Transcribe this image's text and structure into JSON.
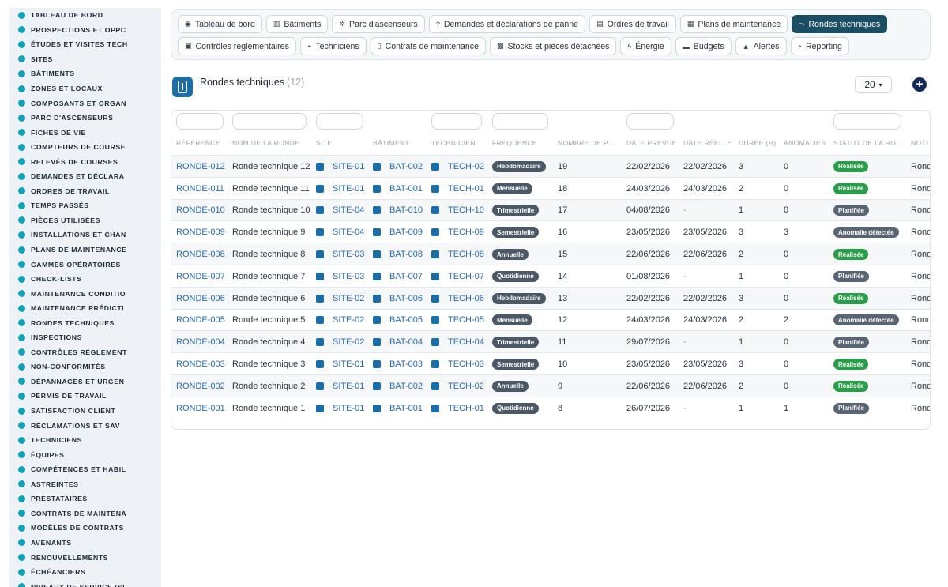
{
  "sidebar": {
    "items": [
      {
        "label": "TABLEAU DE BORD",
        "icon": "dashboard-icon"
      },
      {
        "label": "PROSPECTIONS ET OPPC",
        "icon": "target-icon"
      },
      {
        "label": "ÉTUDES ET VISITES TECH",
        "icon": "document-icon"
      },
      {
        "label": "SITES",
        "icon": "map-pin-icon"
      },
      {
        "label": "BÂTIMENTS",
        "icon": "building-icon"
      },
      {
        "label": "ZONES ET LOCAUX",
        "icon": "door-icon"
      },
      {
        "label": "COMPOSANTS ET ORGAN",
        "icon": "sitemap-icon"
      },
      {
        "label": "PARC D'ASCENSEURS",
        "icon": "gears-icon"
      },
      {
        "label": "FICHES DE VIE",
        "icon": "history-icon"
      },
      {
        "label": "COMPTEURS DE COURSE",
        "icon": "gauge-icon"
      },
      {
        "label": "RELEVÉS DE COURSES",
        "icon": "clipboard-icon"
      },
      {
        "label": "DEMANDES ET DÉCLARA",
        "icon": "question-icon"
      },
      {
        "label": "ORDRES DE TRAVAIL",
        "icon": "clipboard-list-icon"
      },
      {
        "label": "TEMPS PASSÉS",
        "icon": "clock-icon"
      },
      {
        "label": "PIÈCES UTILISÉES",
        "icon": "box-icon"
      },
      {
        "label": "INSTALLATIONS ET CHAN",
        "icon": "hammer-icon"
      },
      {
        "label": "PLANS DE MAINTENANCE",
        "icon": "calendar-icon"
      },
      {
        "label": "GAMMES OPÉRATOIRES",
        "icon": "list-icon"
      },
      {
        "label": "CHECK-LISTS",
        "icon": "checklist-icon"
      },
      {
        "label": "MAINTENANCE CONDITIO",
        "icon": "thermometer-icon"
      },
      {
        "label": "MAINTENANCE PRÉDICTI",
        "icon": "chart-icon"
      },
      {
        "label": "RONDES TECHNIQUES",
        "icon": "route-icon"
      },
      {
        "label": "INSPECTIONS",
        "icon": "search-icon"
      },
      {
        "label": "CONTRÔLES RÉGLEMENT",
        "icon": "check-document-icon"
      },
      {
        "label": "NON-CONFORMITÉS",
        "icon": "alert-circle-icon"
      },
      {
        "label": "DÉPANNAGES ET URGEN",
        "icon": "warning-icon"
      },
      {
        "label": "PERMIS DE TRAVAIL",
        "icon": "id-card-icon"
      },
      {
        "label": "SATISFACTION CLIENT",
        "icon": "smile-icon"
      },
      {
        "label": "RÉCLAMATIONS ET SAV",
        "icon": "comment-icon"
      },
      {
        "label": "TECHNICIENS",
        "icon": "helmet-icon"
      },
      {
        "label": "ÉQUIPES",
        "icon": "users-icon"
      },
      {
        "label": "COMPÉTENCES ET HABIL",
        "icon": "certificate-icon"
      },
      {
        "label": "ASTREINTES",
        "icon": "phone-icon"
      },
      {
        "label": "PRESTATAIRES",
        "icon": "briefcase-icon"
      },
      {
        "label": "CONTRATS DE MAINTENA",
        "icon": "file-contract-icon"
      },
      {
        "label": "MODÈLES DE CONTRATS",
        "icon": "file-icon"
      },
      {
        "label": "AVENANTS",
        "icon": "file-edit-icon"
      },
      {
        "label": "RENOUVELLEMENTS",
        "icon": "refresh-icon"
      },
      {
        "label": "ÉCHÉANCIERS",
        "icon": "file-calendar-icon"
      },
      {
        "label": "NIVEAUX DE SERVICE (SL",
        "icon": "layers-icon"
      }
    ]
  },
  "nav": {
    "row1": [
      {
        "label": "Tableau de bord",
        "icon": "gauge-icon",
        "glyph": "◉",
        "active": false
      },
      {
        "label": "Bâtiments",
        "icon": "building-icon",
        "glyph": "▥",
        "active": false
      },
      {
        "label": "Parc d'ascenseurs",
        "icon": "gears-icon",
        "glyph": "✲",
        "active": false
      },
      {
        "label": "Demandes et déclarations de panne",
        "icon": "question-icon",
        "glyph": "?",
        "active": false
      },
      {
        "label": "Ordres de travail",
        "icon": "clipboard-icon",
        "glyph": "▤",
        "active": false
      },
      {
        "label": "Plans de maintenance",
        "icon": "calendar-icon",
        "glyph": "▦",
        "active": false
      },
      {
        "label": "Rondes techniques",
        "icon": "route-icon",
        "glyph": "⤳",
        "active": true
      }
    ],
    "row2": [
      {
        "label": "Contrôles réglementaires",
        "icon": "check-document-icon",
        "glyph": "▣",
        "active": false
      },
      {
        "label": "Techniciens",
        "icon": "helmet-icon",
        "glyph": "◓",
        "active": false
      },
      {
        "label": "Contrats de maintenance",
        "icon": "file-contract-icon",
        "glyph": "▯",
        "active": false
      },
      {
        "label": "Stocks et pièces détachées",
        "icon": "boxes-icon",
        "glyph": "▩",
        "active": false
      },
      {
        "label": "Énergie",
        "icon": "bolt-icon",
        "glyph": "ϟ",
        "active": false
      },
      {
        "label": "Budgets",
        "icon": "money-icon",
        "glyph": "▬",
        "active": false
      },
      {
        "label": "Alertes",
        "icon": "bell-icon",
        "glyph": "▲",
        "active": false
      },
      {
        "label": "Reporting",
        "icon": "pie-chart-icon",
        "glyph": "◔",
        "active": false
      }
    ]
  },
  "header": {
    "title": "Rondes techniques",
    "count": "(12)",
    "per_page": "20",
    "add_label": "+"
  },
  "table": {
    "columns": [
      "RÉFÉRENCE",
      "NOM DE LA RONDE",
      "SITE",
      "BÂTIMENT",
      "TECHNICIEN",
      "FRÉQUENCE",
      "NOMBRE DE P…",
      "DATE PRÉVUE",
      "DATE RÉELLE",
      "DURÉE (H)",
      "ANOMALIES",
      "STATUT DE LA RO…",
      "NOTE"
    ],
    "status_colors": {
      "Réalisée": "#2a9d4a",
      "Planifiée": "#5a6573",
      "Anomalie détectée": "#5a6573"
    },
    "rows": [
      {
        "ref": "RONDE-012",
        "name": "Ronde technique 12",
        "site": "SITE-01",
        "batiment": "BAT-002",
        "tech": "TECH-02",
        "freq": "Hebdomadaire",
        "points": "19",
        "prevue": "22/02/2026",
        "reelle": "22/02/2026",
        "duree": "3",
        "anomalies": "0",
        "statut": "Réalisée",
        "note": "Ronde"
      },
      {
        "ref": "RONDE-011",
        "name": "Ronde technique 11",
        "site": "SITE-01",
        "batiment": "BAT-001",
        "tech": "TECH-01",
        "freq": "Mensuelle",
        "points": "18",
        "prevue": "24/03/2026",
        "reelle": "24/03/2026",
        "duree": "2",
        "anomalies": "0",
        "statut": "Réalisée",
        "note": "Ronde"
      },
      {
        "ref": "RONDE-010",
        "name": "Ronde technique 10",
        "site": "SITE-04",
        "batiment": "BAT-010",
        "tech": "TECH-10",
        "freq": "Trimestrielle",
        "points": "17",
        "prevue": "04/08/2026",
        "reelle": "-",
        "duree": "1",
        "anomalies": "0",
        "statut": "Planifiée",
        "note": "Ronde"
      },
      {
        "ref": "RONDE-009",
        "name": "Ronde technique 9",
        "site": "SITE-04",
        "batiment": "BAT-009",
        "tech": "TECH-09",
        "freq": "Semestrielle",
        "points": "16",
        "prevue": "23/05/2026",
        "reelle": "23/05/2026",
        "duree": "3",
        "anomalies": "3",
        "statut": "Anomalie détectée",
        "note": "Ronde"
      },
      {
        "ref": "RONDE-008",
        "name": "Ronde technique 8",
        "site": "SITE-03",
        "batiment": "BAT-008",
        "tech": "TECH-08",
        "freq": "Annuelle",
        "points": "15",
        "prevue": "22/06/2026",
        "reelle": "22/06/2026",
        "duree": "2",
        "anomalies": "0",
        "statut": "Réalisée",
        "note": "Ronde"
      },
      {
        "ref": "RONDE-007",
        "name": "Ronde technique 7",
        "site": "SITE-03",
        "batiment": "BAT-007",
        "tech": "TECH-07",
        "freq": "Quotidienne",
        "points": "14",
        "prevue": "01/08/2026",
        "reelle": "-",
        "duree": "1",
        "anomalies": "0",
        "statut": "Planifiée",
        "note": "Ronde"
      },
      {
        "ref": "RONDE-006",
        "name": "Ronde technique 6",
        "site": "SITE-02",
        "batiment": "BAT-006",
        "tech": "TECH-06",
        "freq": "Hebdomadaire",
        "points": "13",
        "prevue": "22/02/2026",
        "reelle": "22/02/2026",
        "duree": "3",
        "anomalies": "0",
        "statut": "Réalisée",
        "note": "Ronde"
      },
      {
        "ref": "RONDE-005",
        "name": "Ronde technique 5",
        "site": "SITE-02",
        "batiment": "BAT-005",
        "tech": "TECH-05",
        "freq": "Mensuelle",
        "points": "12",
        "prevue": "24/03/2026",
        "reelle": "24/03/2026",
        "duree": "2",
        "anomalies": "2",
        "statut": "Anomalie détectée",
        "note": "Ronde"
      },
      {
        "ref": "RONDE-004",
        "name": "Ronde technique 4",
        "site": "SITE-02",
        "batiment": "BAT-004",
        "tech": "TECH-04",
        "freq": "Trimestrielle",
        "points": "11",
        "prevue": "29/07/2026",
        "reelle": "-",
        "duree": "1",
        "anomalies": "0",
        "statut": "Planifiée",
        "note": "Ronde"
      },
      {
        "ref": "RONDE-003",
        "name": "Ronde technique 3",
        "site": "SITE-01",
        "batiment": "BAT-003",
        "tech": "TECH-03",
        "freq": "Semestrielle",
        "points": "10",
        "prevue": "23/05/2026",
        "reelle": "23/05/2026",
        "duree": "3",
        "anomalies": "0",
        "statut": "Réalisée",
        "note": "Ronde"
      },
      {
        "ref": "RONDE-002",
        "name": "Ronde technique 2",
        "site": "SITE-01",
        "batiment": "BAT-002",
        "tech": "TECH-02",
        "freq": "Annuelle",
        "points": "9",
        "prevue": "22/06/2026",
        "reelle": "22/06/2026",
        "duree": "2",
        "anomalies": "0",
        "statut": "Réalisée",
        "note": "Ronde"
      },
      {
        "ref": "RONDE-001",
        "name": "Ronde technique 1",
        "site": "SITE-01",
        "batiment": "BAT-001",
        "tech": "TECH-01",
        "freq": "Quotidienne",
        "points": "8",
        "prevue": "26/07/2026",
        "reelle": "-",
        "duree": "1",
        "anomalies": "1",
        "statut": "Planifiée",
        "note": "Ronde"
      }
    ]
  }
}
